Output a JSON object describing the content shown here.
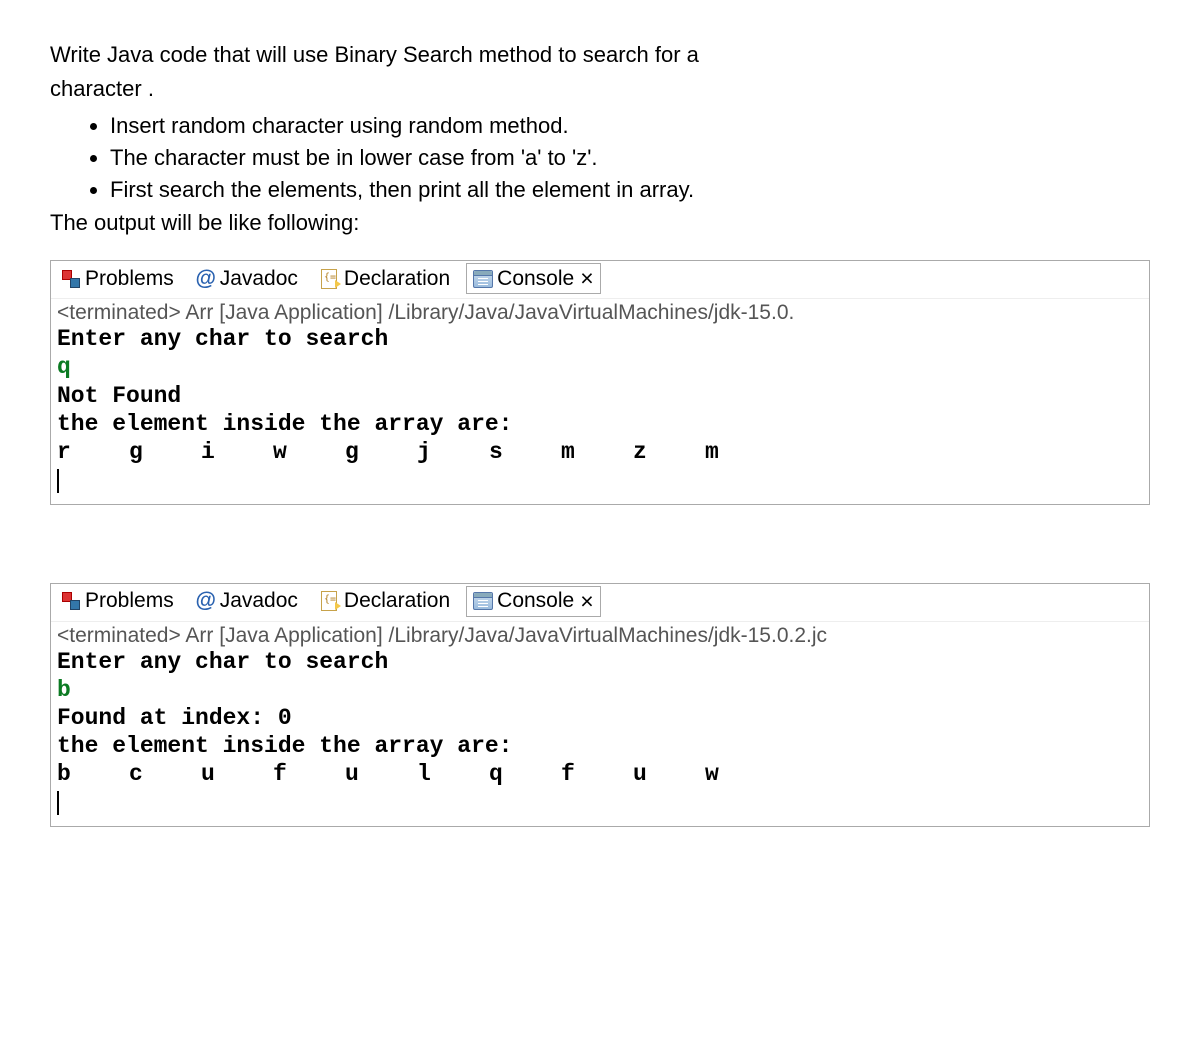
{
  "question": {
    "title_line1": "Write Java code that will use Binary Search method to search for a",
    "title_line2": "character .",
    "bullets": [
      "Insert random character using random method.",
      "The character must be in lower case from 'a' to 'z'.",
      "First search the elements, then print all the element in array."
    ],
    "follow": "The output will be like following:"
  },
  "tabs": {
    "problems": "Problems",
    "javadoc": "Javadoc",
    "declaration": "Declaration",
    "console": "Console"
  },
  "close_glyph": "×",
  "panel1": {
    "status": "<terminated> Arr [Java Application] /Library/Java/JavaVirtualMachines/jdk-15.0.",
    "prompt": "Enter any char to search",
    "input": "q",
    "result": "Not Found",
    "array_label": "the element inside the array are:",
    "array": [
      "r",
      "g",
      "i",
      "w",
      "g",
      "j",
      "s",
      "m",
      "z",
      "m"
    ]
  },
  "panel2": {
    "status": "<terminated> Arr [Java Application] /Library/Java/JavaVirtualMachines/jdk-15.0.2.jc",
    "prompt": "Enter any char to search",
    "input": "b",
    "result": "Found at index: 0",
    "array_label": "the element inside the array are:",
    "array": [
      "b",
      "c",
      "u",
      "f",
      "u",
      "l",
      "q",
      "f",
      "u",
      "w"
    ]
  }
}
